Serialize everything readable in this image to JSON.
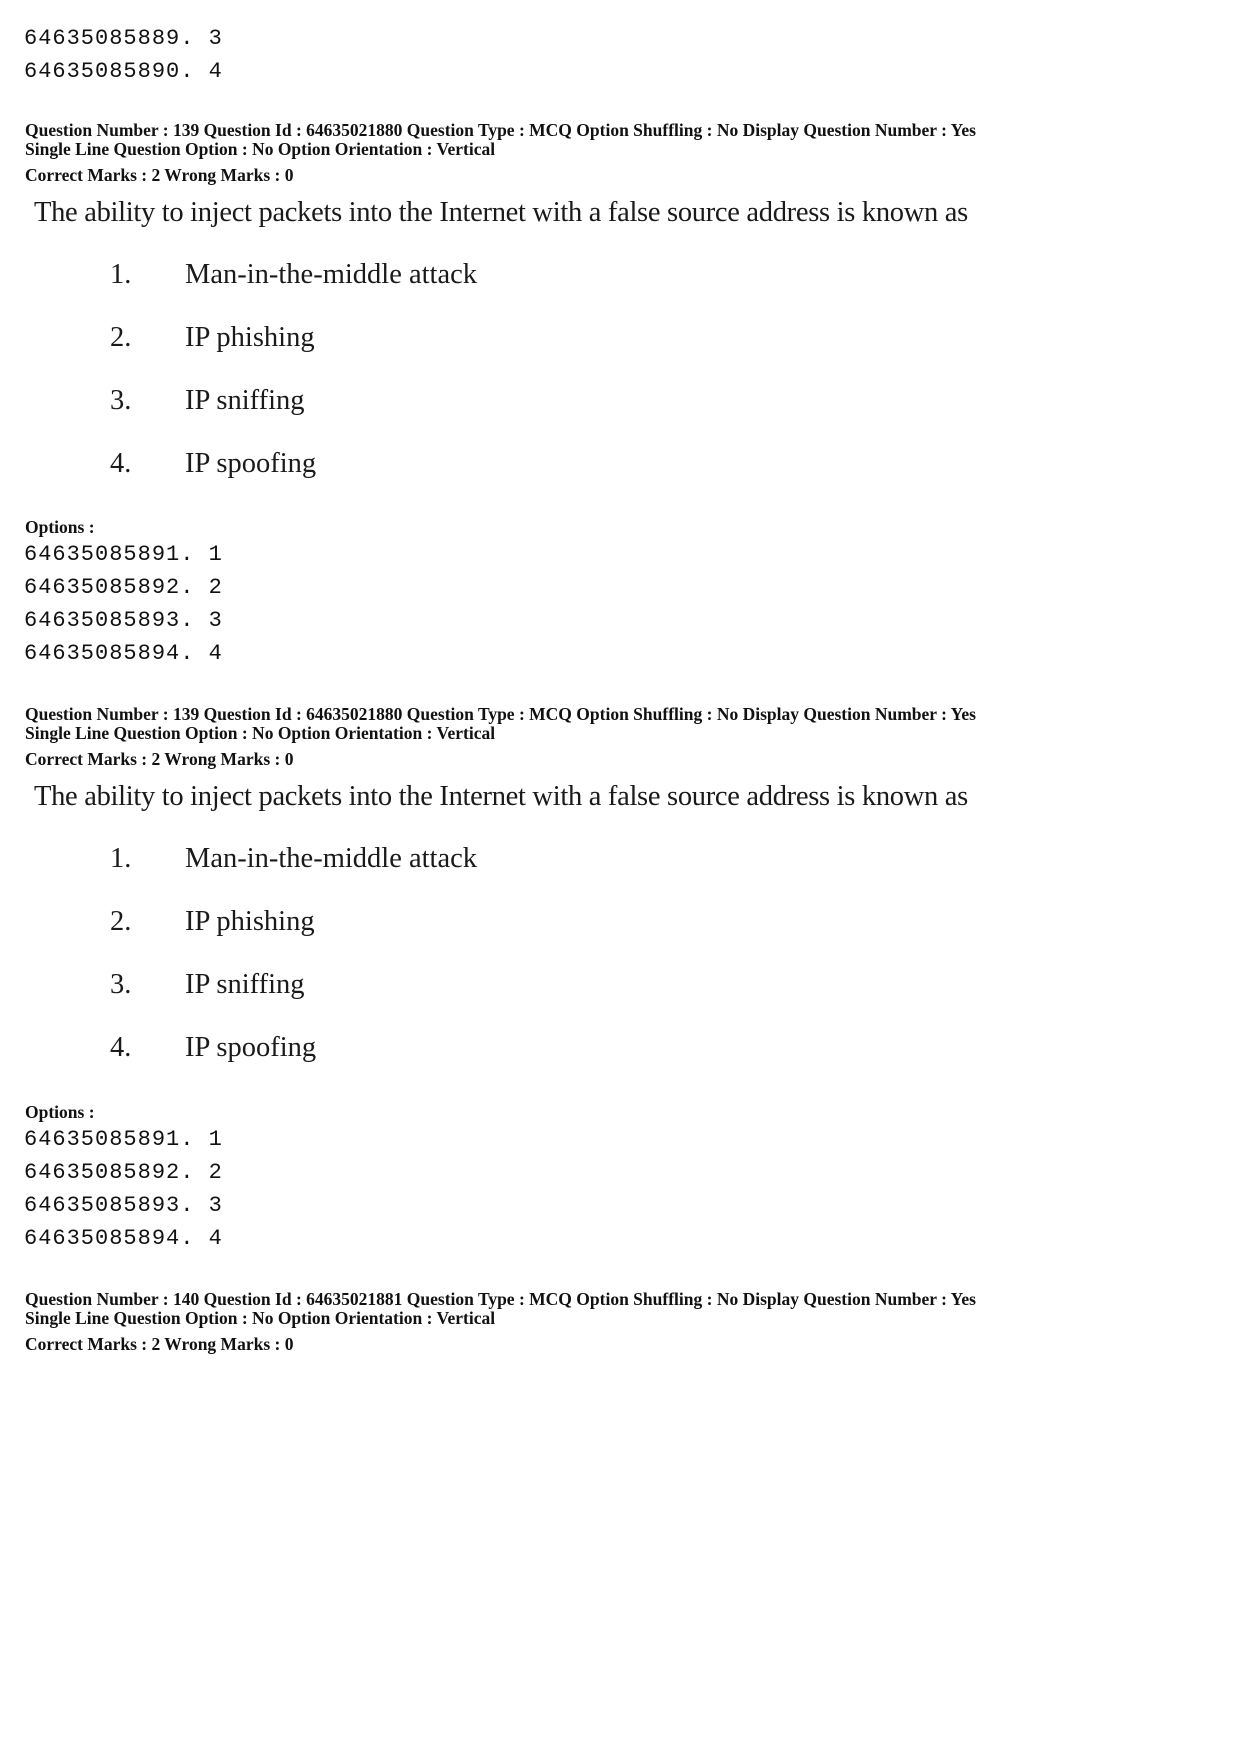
{
  "top_options": [
    {
      "id": "64635085889",
      "label": "3"
    },
    {
      "id": "64635085890",
      "label": "4"
    }
  ],
  "blocks": [
    {
      "meta_line1": "Question Number : 139  Question Id : 64635021880  Question Type : MCQ  Option Shuffling : No  Display Question Number : Yes",
      "meta_line2": "Single Line Question Option : No  Option Orientation : Vertical",
      "marks": "Correct Marks : 2  Wrong Marks : 0",
      "question": "The ability to inject packets into the Internet with a false source address is known as",
      "choices": [
        {
          "num": "1.",
          "text": "Man-in-the-middle attack"
        },
        {
          "num": "2.",
          "text": "IP phishing"
        },
        {
          "num": "3.",
          "text": "IP sniffing"
        },
        {
          "num": "4.",
          "text": "IP spoofing"
        }
      ],
      "options_label": "Options :",
      "options": [
        {
          "id": "64635085891",
          "label": "1"
        },
        {
          "id": "64635085892",
          "label": "2"
        },
        {
          "id": "64635085893",
          "label": "3"
        },
        {
          "id": "64635085894",
          "label": "4"
        }
      ]
    },
    {
      "meta_line1": "Question Number : 139  Question Id : 64635021880  Question Type : MCQ  Option Shuffling : No  Display Question Number : Yes",
      "meta_line2": "Single Line Question Option : No  Option Orientation : Vertical",
      "marks": "Correct Marks : 2  Wrong Marks : 0",
      "question": "The ability to inject packets into the Internet with a false source address is known as",
      "choices": [
        {
          "num": "1.",
          "text": "Man-in-the-middle attack"
        },
        {
          "num": "2.",
          "text": "IP phishing"
        },
        {
          "num": "3.",
          "text": "IP sniffing"
        },
        {
          "num": "4.",
          "text": "IP spoofing"
        }
      ],
      "options_label": "Options :",
      "options": [
        {
          "id": "64635085891",
          "label": "1"
        },
        {
          "id": "64635085892",
          "label": "2"
        },
        {
          "id": "64635085893",
          "label": "3"
        },
        {
          "id": "64635085894",
          "label": "4"
        }
      ]
    },
    {
      "meta_line1": "Question Number : 140  Question Id : 64635021881  Question Type : MCQ  Option Shuffling : No  Display Question Number : Yes",
      "meta_line2": "Single Line Question Option : No  Option Orientation : Vertical",
      "marks": "Correct Marks : 2  Wrong Marks : 0"
    }
  ]
}
